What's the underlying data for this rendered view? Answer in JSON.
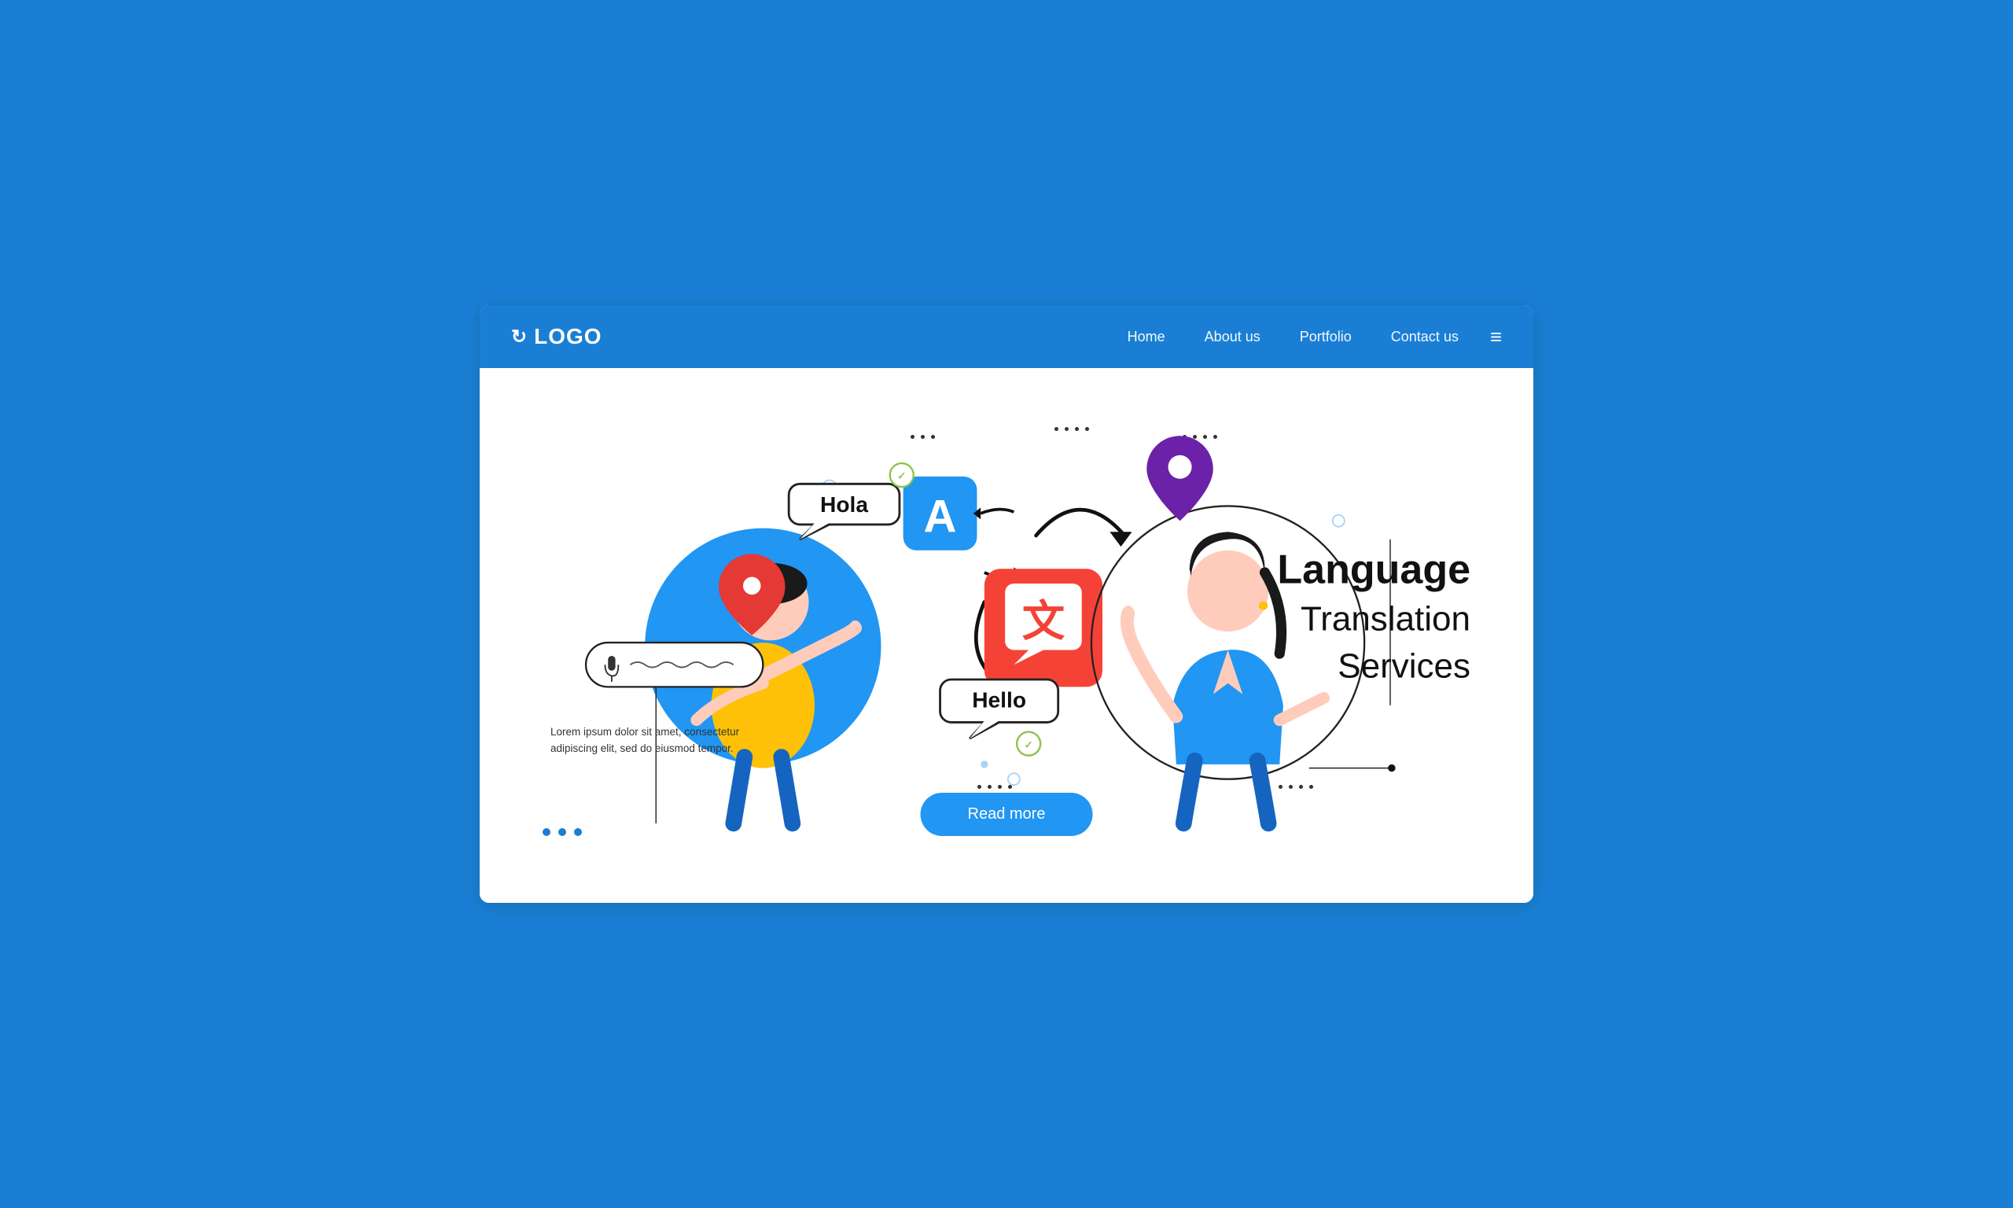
{
  "navbar": {
    "logo_icon": "↻",
    "logo_text": "LOGO",
    "nav": [
      {
        "label": "Home",
        "id": "home"
      },
      {
        "label": "About us",
        "id": "about"
      },
      {
        "label": "Portfolio",
        "id": "portfolio"
      },
      {
        "label": "Contact us",
        "id": "contact"
      }
    ],
    "menu_icon": "≡"
  },
  "hero": {
    "mic_label": "mic",
    "speech_hola": "Hola",
    "speech_hello": "Hello",
    "translate_a": "A",
    "translate_chinese": "文",
    "body_text": "Lorem ipsum dolor sit amet, consectetur\nadipiscing elit, sed do eiusmod tempor.",
    "title_line1": "Language",
    "title_line2": "Translation",
    "title_line3": "Services",
    "read_more": "Read more"
  },
  "colors": {
    "brand_blue": "#1a7fd4",
    "nav_bg": "#1a7fd4",
    "hero_bg": "#ffffff",
    "btn_blue": "#2196F3",
    "icon_a_bg": "#2196F3",
    "icon_zh_bg": "#F44336",
    "man_circle": "#2196F3",
    "checkmark": "#8BC34A",
    "pin": "#6B21A8"
  }
}
